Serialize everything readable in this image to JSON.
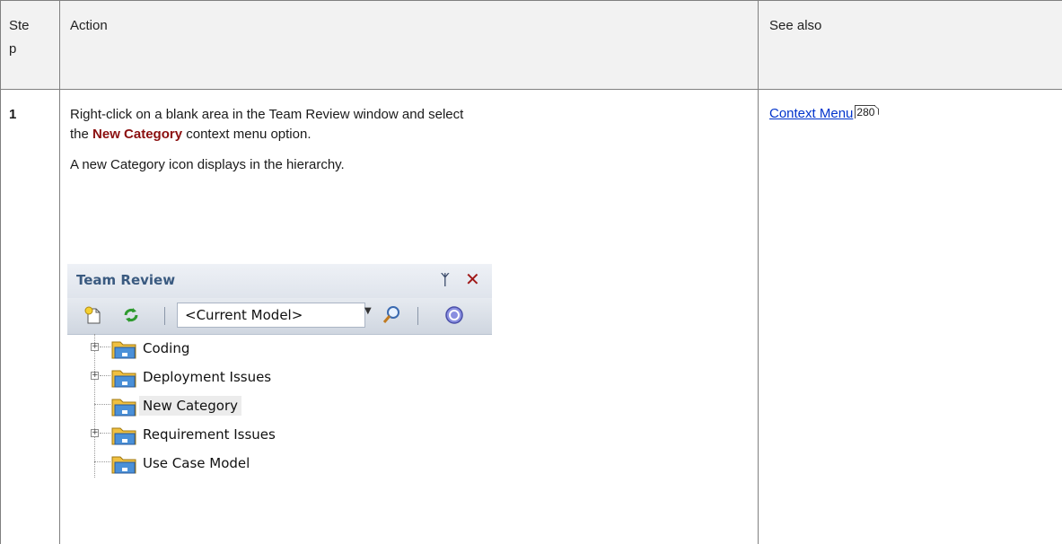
{
  "table": {
    "headers": {
      "step": "Ste\np",
      "action": "Action",
      "see_also": "See also"
    },
    "row": {
      "step": "1",
      "action_line1_pre": "Right-click on a blank area in the Team Review window and select",
      "action_line2_pre": "the ",
      "action_line2_bold": "New Category",
      "action_line2_post": " context menu option.",
      "action_line3": "A new Category icon displays in the hierarchy.",
      "see_also_link": "Context Menu",
      "see_also_page": "280"
    }
  },
  "team_review": {
    "title": "Team Review",
    "model_select_value": "<Current Model>",
    "tree_items": [
      {
        "label": "Coding",
        "expandable": true,
        "selected": false
      },
      {
        "label": "Deployment Issues",
        "expandable": true,
        "selected": false
      },
      {
        "label": "New Category",
        "expandable": false,
        "selected": true
      },
      {
        "label": "Requirement Issues",
        "expandable": true,
        "selected": false
      },
      {
        "label": "Use Case Model",
        "expandable": false,
        "selected": false
      }
    ]
  },
  "colors": {
    "bold_text": "#8b1010",
    "link": "#0033cc",
    "panel_title": "#3a5a80",
    "close_icon": "#a01818"
  }
}
